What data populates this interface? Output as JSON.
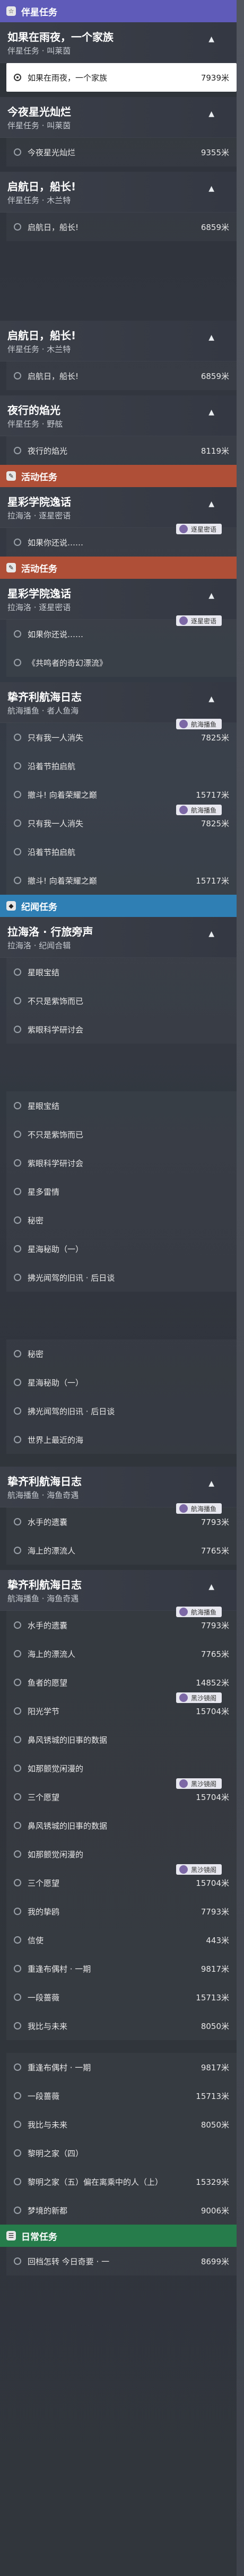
{
  "sections": {
    "companion": "伴星任务",
    "activity": "活动任务",
    "trailblaze": "纪闻任务",
    "daily": "日常任务"
  },
  "cards": {
    "family_title": "如果在雨夜，一个家族",
    "family_sub": "伴星任务 · 叫莱茵",
    "sunset_title": "今夜星光灿烂",
    "sunset_sub": "伴星任务 · 叫莱茵",
    "sail1_title": "启航日，船长!",
    "sail1_sub": "伴星任务 · 木兰特",
    "sail2_title": "启航日，船长!",
    "sail2_sub": "伴星任务 · 木兰特",
    "night_title": "夜行的焰光",
    "night_sub": "伴星任务 · 野舷",
    "academy_title": "星彩学院逸话",
    "academy_sub": "拉海洛 · 逐星密语",
    "academy2_title": "星彩学院逸话",
    "academy2_sub": "拉海洛 · 逐星密语",
    "log1_title": "挚齐利航海日志",
    "log1_sub": "航海播鱼 · 者人鱼海",
    "trail_title": "拉海洛 · 行旅旁声",
    "trail_sub": "拉海洛 · 纪闻合辑",
    "log2_title": "挚齐利航海日志",
    "log2_sub": "航海播鱼 · 海鱼奇遇",
    "log3_title": "挚齐利航海日志",
    "log3_sub": "航海播鱼 · 海鱼奇遇"
  },
  "rows": {
    "r1": {
      "label": "如果在雨夜，一个家族",
      "dist": "7939米"
    },
    "r2": {
      "label": "今夜星光灿烂",
      "dist": "9355米"
    },
    "r3": {
      "label": "启航日，船长!",
      "dist": "6859米"
    },
    "r4": {
      "label": "启航日，船长!",
      "dist": "6859米"
    },
    "r5": {
      "label": "夜行的焰光",
      "dist": "8119米"
    },
    "r6": {
      "label": "如果你还说……",
      "dist": ""
    },
    "r7": {
      "label": "如果你还说……",
      "dist": ""
    },
    "r8": {
      "label": "《共鸣者的奇幻漂流》",
      "dist": ""
    },
    "r9": {
      "label": "只有我一人消失",
      "dist": "7825米"
    },
    "r10": {
      "label": "沿着节拍启航",
      "dist": ""
    },
    "r11": {
      "label": "撤斗! 向着荣耀之巅",
      "dist": "15717米"
    },
    "r12": {
      "label": "只有我一人消失",
      "dist": "7825米"
    },
    "r13": {
      "label": "沿着节拍启航",
      "dist": ""
    },
    "r14": {
      "label": "撤斗! 向着荣耀之巅",
      "dist": "15717米"
    },
    "r15": {
      "label": "星眼宝结",
      "dist": ""
    },
    "r16": {
      "label": "不只是紫饰而已",
      "dist": ""
    },
    "r17": {
      "label": "紫眼科学研讨会",
      "dist": ""
    },
    "r18": {
      "label": "星眼宝结",
      "dist": ""
    },
    "r19": {
      "label": "不只是紫饰而已",
      "dist": ""
    },
    "r20": {
      "label": "紫眼科学研讨会",
      "dist": ""
    },
    "r21": {
      "label": "星多雷情",
      "dist": ""
    },
    "r22": {
      "label": "秘密",
      "dist": ""
    },
    "r23": {
      "label": "星海秘助（一）",
      "dist": ""
    },
    "r24": {
      "label": "拂光闻驾的旧讯 · 后日谈",
      "dist": ""
    },
    "r25": {
      "label": "秘密",
      "dist": ""
    },
    "r26": {
      "label": "星海秘助（一）",
      "dist": ""
    },
    "r27": {
      "label": "拂光闻驾的旧讯 · 后日谈",
      "dist": ""
    },
    "r28": {
      "label": "世界上最近的海",
      "dist": ""
    },
    "r29": {
      "label": "水手的遗囊",
      "dist": "7793米"
    },
    "r30": {
      "label": "海上的漂流人",
      "dist": "7765米"
    },
    "r31": {
      "label": "水手的遗囊",
      "dist": "7793米"
    },
    "r32": {
      "label": "海上的漂流人",
      "dist": "7765米"
    },
    "r33": {
      "label": "鱼者的愿望",
      "dist": "14852米"
    },
    "r34": {
      "label": "阳光学节",
      "dist": "15704米"
    },
    "r35": {
      "label": "鼻风锈城的旧事的数据",
      "dist": ""
    },
    "r36": {
      "label": "如那颤觉闲漫的",
      "dist": ""
    },
    "r37": {
      "label": "三个愿望",
      "dist": "15704米"
    },
    "r38": {
      "label": "鼻风锈城的旧事的数据",
      "dist": ""
    },
    "r39": {
      "label": "如那颤觉闲漫的",
      "dist": ""
    },
    "r40": {
      "label": "三个愿望",
      "dist": "15704米"
    },
    "r41": {
      "label": "我的挚鸥",
      "dist": "7793米"
    },
    "r42": {
      "label": "信使",
      "dist": "443米"
    },
    "r43": {
      "label": "重逢布偶村 · 一期",
      "dist": "9817米"
    },
    "r44": {
      "label": "一段蔷薇",
      "dist": "15713米"
    },
    "r45": {
      "label": "我比与未来",
      "dist": "8050米"
    },
    "r46": {
      "label": "重逢布偶村 · 一期",
      "dist": "9817米"
    },
    "r47": {
      "label": "一段蔷薇",
      "dist": "15713米"
    },
    "r48": {
      "label": "我比与未来",
      "dist": "8050米"
    },
    "r49": {
      "label": "黎明之家（四）",
      "dist": ""
    },
    "r50": {
      "label": "黎明之家（五）偏在离乘中的人（上）",
      "dist": "15329米"
    },
    "r51": {
      "label": "梦境的新都",
      "dist": "9006米"
    },
    "r52": {
      "label": "回档怎转 今日奇要 · 一",
      "dist": "8699米"
    }
  },
  "tags": {
    "star_secret": "逐星密语",
    "sea_travel": "航海播鱼",
    "desert": "黑沙镜阁"
  }
}
